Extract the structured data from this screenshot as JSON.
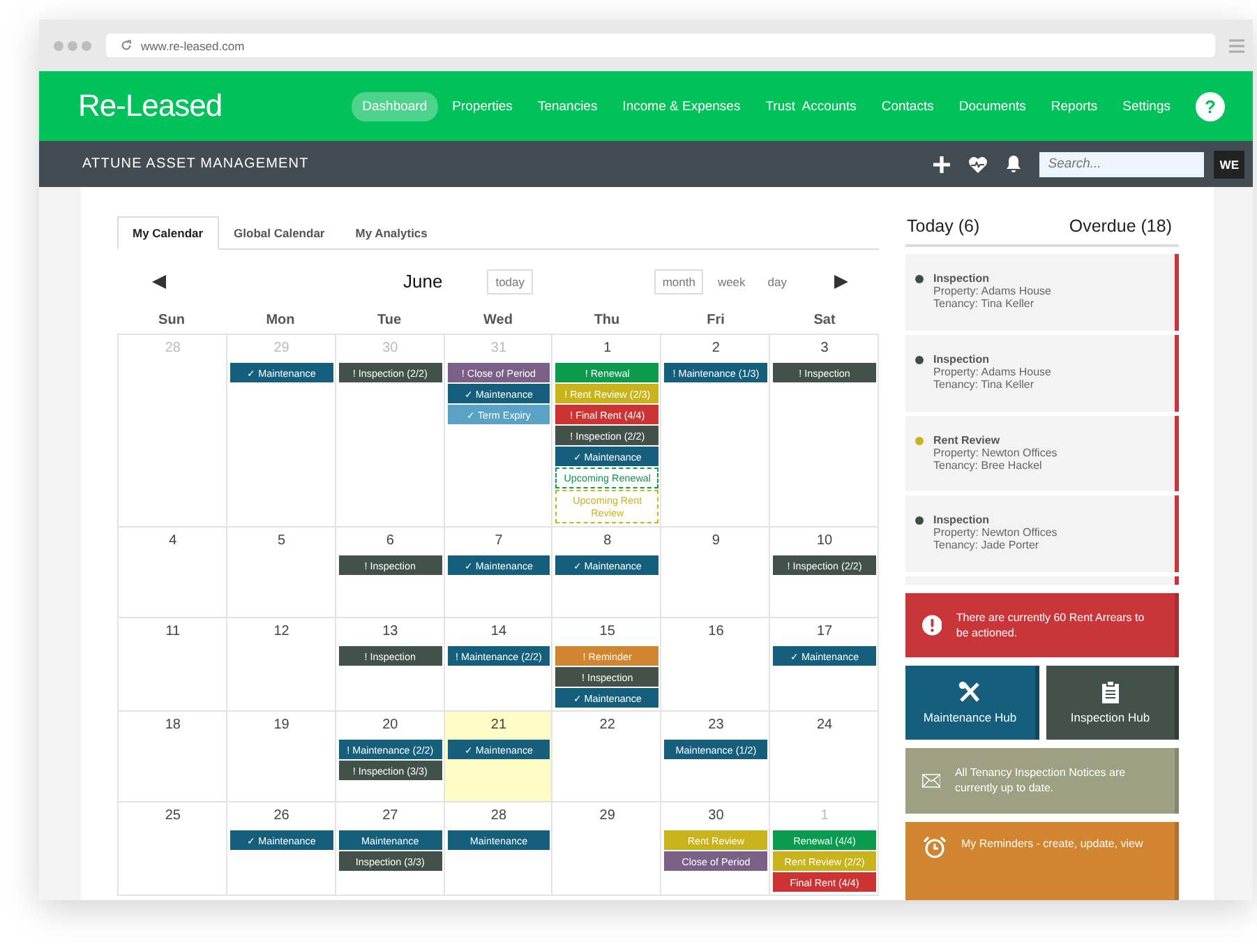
{
  "browser": {
    "url": "www.re-leased.com"
  },
  "header": {
    "logo": "Re-Leased",
    "help": "?",
    "nav": [
      {
        "label": "Dashboard",
        "selected": true
      },
      {
        "label": "Properties",
        "selected": false
      },
      {
        "label": "Tenancies",
        "selected": false
      },
      {
        "label": "Income & Expenses",
        "selected": false
      },
      {
        "label": "Trust  Accounts",
        "selected": false
      },
      {
        "label": "Contacts",
        "selected": false
      },
      {
        "label": "Documents",
        "selected": false
      },
      {
        "label": "Reports",
        "selected": false
      },
      {
        "label": "Settings",
        "selected": false
      }
    ]
  },
  "subheader": {
    "company": "ATTUNE ASSET MANAGEMENT",
    "search": {
      "placeholder": "Search..."
    },
    "avatar": "WE"
  },
  "calendar": {
    "tabs": [
      {
        "label": "My Calendar",
        "selected": true
      },
      {
        "label": "Global Calendar",
        "selected": false
      },
      {
        "label": "My Analytics",
        "selected": false
      }
    ],
    "month": "June",
    "today_button": "today",
    "views": [
      {
        "label": "month",
        "selected": true
      },
      {
        "label": "week",
        "selected": false
      },
      {
        "label": "day",
        "selected": false
      }
    ],
    "weekdays": [
      "Sun",
      "Mon",
      "Tue",
      "Wed",
      "Thu",
      "Fri",
      "Sat"
    ],
    "weeks": [
      [
        {
          "day": "28",
          "other_month": true,
          "today": false
        },
        {
          "day": "29",
          "other_month": true,
          "today": false,
          "events": [
            {
              "label": "✓ Maintenance",
              "kind": "maintenance"
            }
          ]
        },
        {
          "day": "30",
          "other_month": true,
          "today": false,
          "events": [
            {
              "label": "! Inspection (2/2)",
              "kind": "inspection"
            }
          ]
        },
        {
          "day": "31",
          "other_month": true,
          "today": false,
          "events": [
            {
              "label": "! Close of Period",
              "kind": "period"
            },
            {
              "label": "✓ Maintenance",
              "kind": "maintenance"
            },
            {
              "label": "✓ Term Expiry",
              "kind": "expiry"
            }
          ]
        },
        {
          "day": "1",
          "other_month": false,
          "today": false,
          "events": [
            {
              "label": "! Renewal",
              "kind": "renewal"
            },
            {
              "label": "! Rent Review (2/3)",
              "kind": "review"
            },
            {
              "label": "! Final Rent (4/4)",
              "kind": "finalrent"
            },
            {
              "label": "! Inspection (2/2)",
              "kind": "inspection"
            },
            {
              "label": "✓ Maintenance",
              "kind": "maintenance"
            },
            {
              "label": "Upcoming Renewal",
              "kind": "pendingrenewal"
            },
            {
              "label": "Upcoming Rent Review",
              "kind": "pendingreview"
            }
          ]
        },
        {
          "day": "2",
          "other_month": false,
          "today": false,
          "events": [
            {
              "label": "! Maintenance (1/3)",
              "kind": "maintenance"
            }
          ]
        },
        {
          "day": "3",
          "other_month": false,
          "today": false,
          "events": [
            {
              "label": "! Inspection",
              "kind": "inspection"
            }
          ]
        }
      ],
      [
        {
          "day": "4",
          "other_month": false,
          "today": false
        },
        {
          "day": "5",
          "other_month": false,
          "today": false
        },
        {
          "day": "6",
          "other_month": false,
          "today": false,
          "events": [
            {
              "label": "! Inspection",
              "kind": "inspection"
            }
          ]
        },
        {
          "day": "7",
          "other_month": false,
          "today": false,
          "events": [
            {
              "label": "✓ Maintenance",
              "kind": "maintenance"
            }
          ]
        },
        {
          "day": "8",
          "other_month": false,
          "today": false,
          "events": [
            {
              "label": "✓ Maintenance",
              "kind": "maintenance"
            }
          ]
        },
        {
          "day": "9",
          "other_month": false,
          "today": false
        },
        {
          "day": "10",
          "other_month": false,
          "today": false,
          "events": [
            {
              "label": "! Inspection (2/2)",
              "kind": "inspection"
            }
          ]
        }
      ],
      [
        {
          "day": "11",
          "other_month": false,
          "today": false
        },
        {
          "day": "12",
          "other_month": false,
          "today": false
        },
        {
          "day": "13",
          "other_month": false,
          "today": false,
          "events": [
            {
              "label": "! Inspection",
              "kind": "inspection"
            }
          ]
        },
        {
          "day": "14",
          "other_month": false,
          "today": false,
          "events": [
            {
              "label": "! Maintenance (2/2)",
              "kind": "maintenance"
            }
          ]
        },
        {
          "day": "15",
          "other_month": false,
          "today": false,
          "events": [
            {
              "label": "! Reminder",
              "kind": "reminder"
            },
            {
              "label": "! Inspection",
              "kind": "inspection"
            },
            {
              "label": "✓ Maintenance",
              "kind": "maintenance"
            }
          ]
        },
        {
          "day": "16",
          "other_month": false,
          "today": false
        },
        {
          "day": "17",
          "other_month": false,
          "today": false,
          "events": [
            {
              "label": "✓ Maintenance",
              "kind": "maintenance"
            }
          ]
        }
      ],
      [
        {
          "day": "18",
          "other_month": false,
          "today": false
        },
        {
          "day": "19",
          "other_month": false,
          "today": false
        },
        {
          "day": "20",
          "other_month": false,
          "today": false,
          "events": [
            {
              "label": "! Maintenance (2/2)",
              "kind": "maintenance"
            },
            {
              "label": "! Inspection (3/3)",
              "kind": "inspection"
            }
          ]
        },
        {
          "day": "21",
          "other_month": false,
          "today": true,
          "events": [
            {
              "label": "✓ Maintenance",
              "kind": "maintenance"
            }
          ]
        },
        {
          "day": "22",
          "other_month": false,
          "today": false
        },
        {
          "day": "23",
          "other_month": false,
          "today": false,
          "events": [
            {
              "label": "Maintenance (1/2)",
              "kind": "maintenance"
            }
          ]
        },
        {
          "day": "24",
          "other_month": false,
          "today": false
        }
      ],
      [
        {
          "day": "25",
          "other_month": false,
          "today": false
        },
        {
          "day": "26",
          "other_month": false,
          "today": false,
          "events": [
            {
              "label": "✓ Maintenance",
              "kind": "maintenance"
            }
          ]
        },
        {
          "day": "27",
          "other_month": false,
          "today": false,
          "events": [
            {
              "label": "Maintenance",
              "kind": "maintenance"
            },
            {
              "label": "Inspection (3/3)",
              "kind": "inspection"
            }
          ]
        },
        {
          "day": "28",
          "other_month": false,
          "today": false,
          "events": [
            {
              "label": "Maintenance",
              "kind": "maintenance"
            }
          ]
        },
        {
          "day": "29",
          "other_month": false,
          "today": false
        },
        {
          "day": "30",
          "other_month": false,
          "today": false,
          "events": [
            {
              "label": "Rent Review",
              "kind": "review"
            },
            {
              "label": "Close of Period",
              "kind": "period"
            }
          ]
        },
        {
          "day": "1",
          "other_month": true,
          "today": false,
          "events": [
            {
              "label": "Renewal (4/4)",
              "kind": "renewal"
            },
            {
              "label": "Rent Review (2/2)",
              "kind": "review"
            },
            {
              "label": "Final Rent (4/4)",
              "kind": "finalrent"
            }
          ]
        }
      ]
    ]
  },
  "sidebar": {
    "today_label": "Today (6)",
    "overdue_label": "Overdue (18)",
    "tasks": [
      {
        "title": "Inspection",
        "property": "Property: Adams House",
        "tenancy": "Tenancy: Tina Keller",
        "color": "#3d4f45"
      },
      {
        "title": "Inspection",
        "property": "Property: Adams House",
        "tenancy": "Tenancy: Tina Keller",
        "color": "#3d4f45"
      },
      {
        "title": "Rent Review",
        "property": "Property: Newton Offices",
        "tenancy": "Tenancy: Bree Hackel",
        "color": "#c9b31c"
      },
      {
        "title": "Inspection",
        "property": "Property: Newton Offices",
        "tenancy": "Tenancy: Jade Porter",
        "color": "#3d4f45"
      }
    ],
    "arrears": "There are currently 60 Rent Arrears to be actioned.",
    "hubs": [
      {
        "label": "Maintenance Hub",
        "kind": "maintenance"
      },
      {
        "label": "Inspection Hub",
        "kind": "inspection"
      }
    ],
    "notices": "All Tenancy Inspection Notices are currently up to date.",
    "reminders": "My Reminders - create, update, view"
  }
}
